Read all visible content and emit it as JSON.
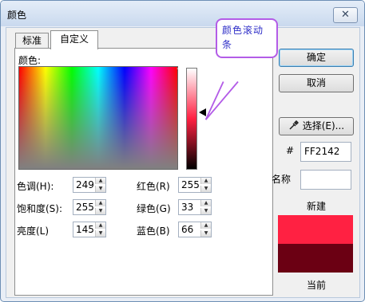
{
  "window": {
    "title": "颜色",
    "close_glyph": "✕"
  },
  "tabs": [
    "标准",
    "自定义"
  ],
  "colors_label": "颜色:",
  "callout_text": "颜色滚动条",
  "fields": [
    {
      "label": "色调(H):",
      "value": "249"
    },
    {
      "label": "饱和度(S):",
      "value": "255"
    },
    {
      "label": "亮度(L)",
      "value": "145"
    },
    {
      "label": "红色(R)",
      "value": "255"
    },
    {
      "label": "绿色(G)",
      "value": "33"
    },
    {
      "label": "蓝色(B)",
      "value": "66"
    }
  ],
  "buttons": {
    "ok": "确定",
    "cancel": "取消",
    "pick": "选择(E)..."
  },
  "hex": {
    "label": "#",
    "value": "FF2142"
  },
  "name": {
    "label": "名称",
    "value": ""
  },
  "new_label": "新建",
  "current_label": "当前",
  "colors": {
    "new": "#ff2142",
    "current": "#6b0013",
    "callout_border": "#b35ce7",
    "callout_text": "#2f2fc8"
  },
  "icons": {
    "eyedropper": "eyedropper-icon",
    "spin_up": "▲",
    "spin_down": "▼"
  }
}
